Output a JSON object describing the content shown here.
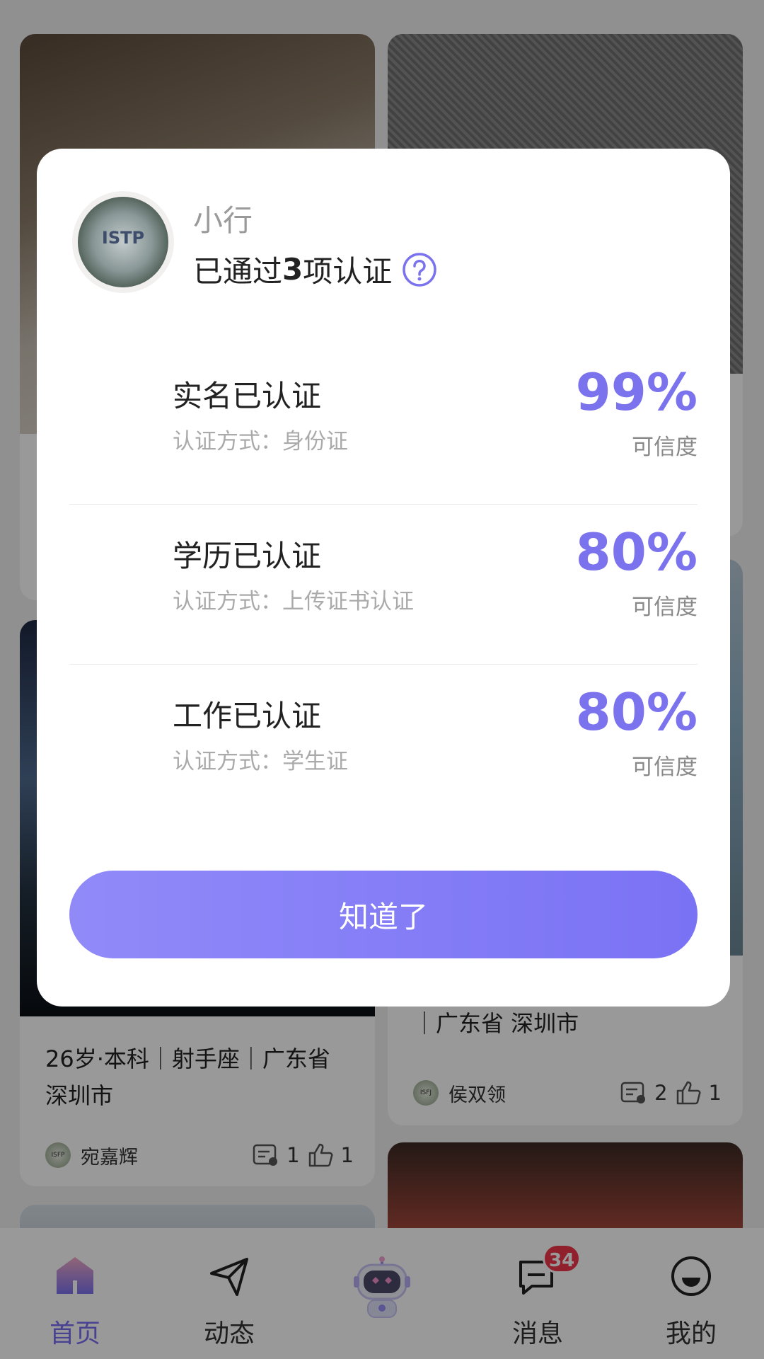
{
  "modal": {
    "avatar_label": "ISTP",
    "username": "小行",
    "summary_prefix": "已通过",
    "summary_count": "3",
    "summary_suffix": "项认证",
    "certifications": [
      {
        "title": "实名已认证",
        "method": "认证方式：身份证",
        "percent": "99%",
        "caption": "可信度"
      },
      {
        "title": "学历已认证",
        "method": "认证方式：上传证书认证",
        "percent": "80%",
        "caption": "可信度"
      },
      {
        "title": "工作已认证",
        "method": "认证方式：学生证",
        "percent": "80%",
        "caption": "可信度"
      }
    ],
    "confirm_label": "知道了"
  },
  "feed": {
    "cards": [
      {
        "info": "26岁·本科｜射手座｜广东省 深圳市",
        "author": "宛嘉辉",
        "mbti": "ISFP",
        "comments": "1",
        "likes": "1"
      },
      {
        "info": "｜广东省 深圳市",
        "author": "侯双领",
        "mbti": "ISFJ",
        "comments": "2",
        "likes": "1"
      }
    ]
  },
  "tabbar": {
    "tabs": [
      {
        "label": "首页",
        "icon": "home-icon"
      },
      {
        "label": "动态",
        "icon": "send-icon"
      },
      {
        "label": "",
        "icon": "robot-icon"
      },
      {
        "label": "消息",
        "icon": "message-icon",
        "badge": "34"
      },
      {
        "label": "我的",
        "icon": "profile-icon"
      }
    ],
    "active": 0
  },
  "colors": {
    "accent": "#7b72ee",
    "badge": "#f2364c",
    "button_start": "#908af9",
    "button_end": "#7a72f4"
  }
}
